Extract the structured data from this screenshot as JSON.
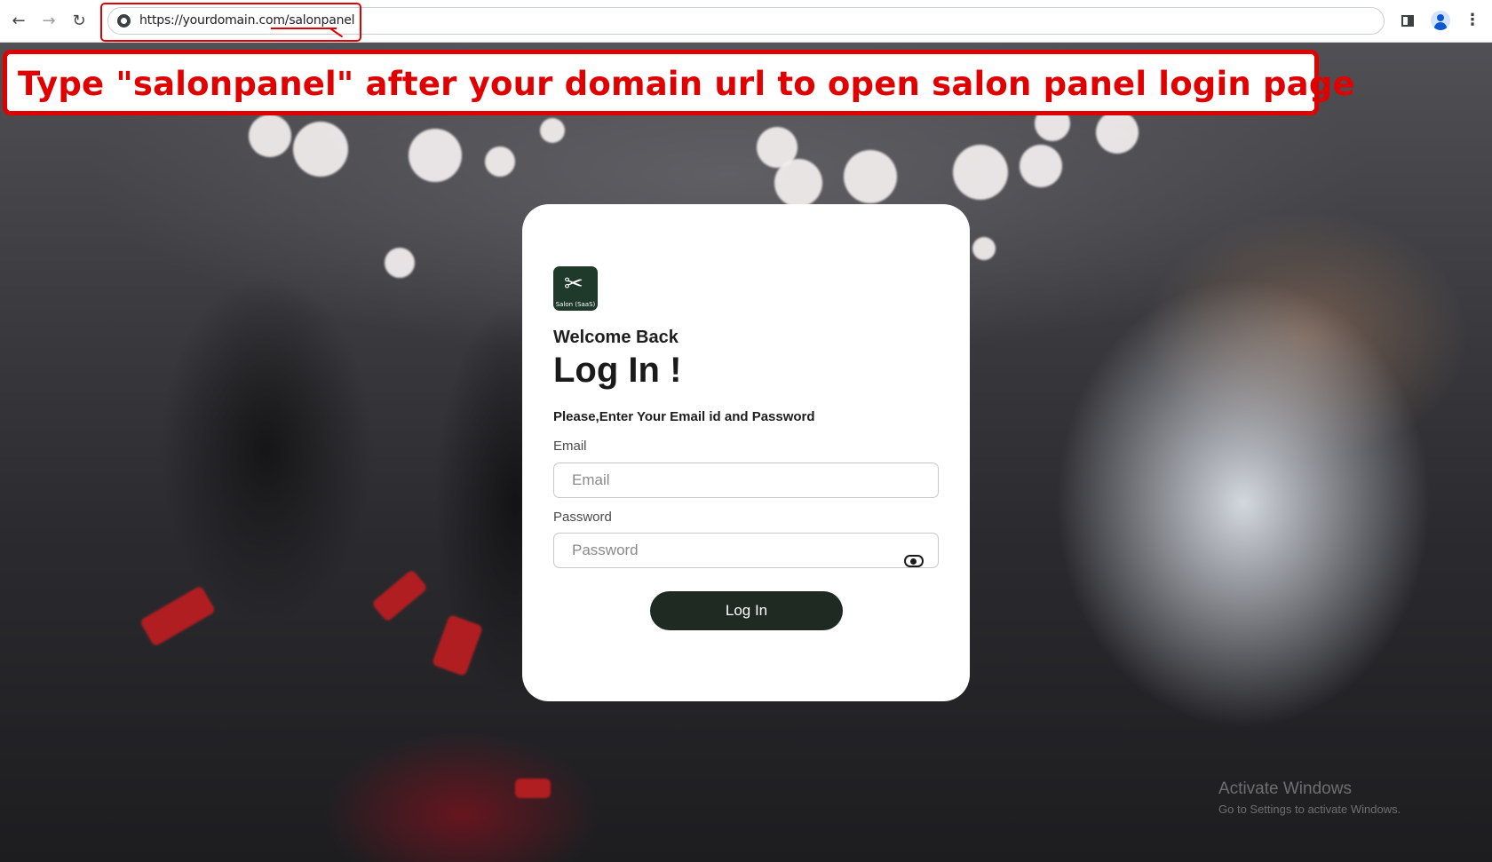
{
  "browser": {
    "back_icon": "arrow-left-icon",
    "forward_icon": "arrow-right-icon",
    "reload_icon": "reload-icon",
    "site_info_icon": "site-info-icon",
    "url": "https://yourdomain.com/salonpanel",
    "side_panel_icon": "side-panel-icon",
    "profile_icon": "profile-icon",
    "menu_icon": "more-vertical-icon"
  },
  "annotation": {
    "text": "Type \"salonpanel\" after your domain url to open salon panel login page",
    "color": "#e00000"
  },
  "login": {
    "logo_label": "Salon (SaaS)",
    "welcome": "Welcome Back",
    "title": "Log In !",
    "subtitle": "Please,Enter Your Email id and Password",
    "email_label": "Email",
    "email_placeholder": "Email",
    "email_value": "",
    "password_label": "Password",
    "password_placeholder": "Password",
    "password_value": "",
    "show_password_icon": "eye-icon",
    "submit_label": "Log In",
    "button_color": "#1f2a22"
  },
  "watermark": {
    "title": "Activate Windows",
    "subtitle": "Go to Settings to activate Windows."
  }
}
